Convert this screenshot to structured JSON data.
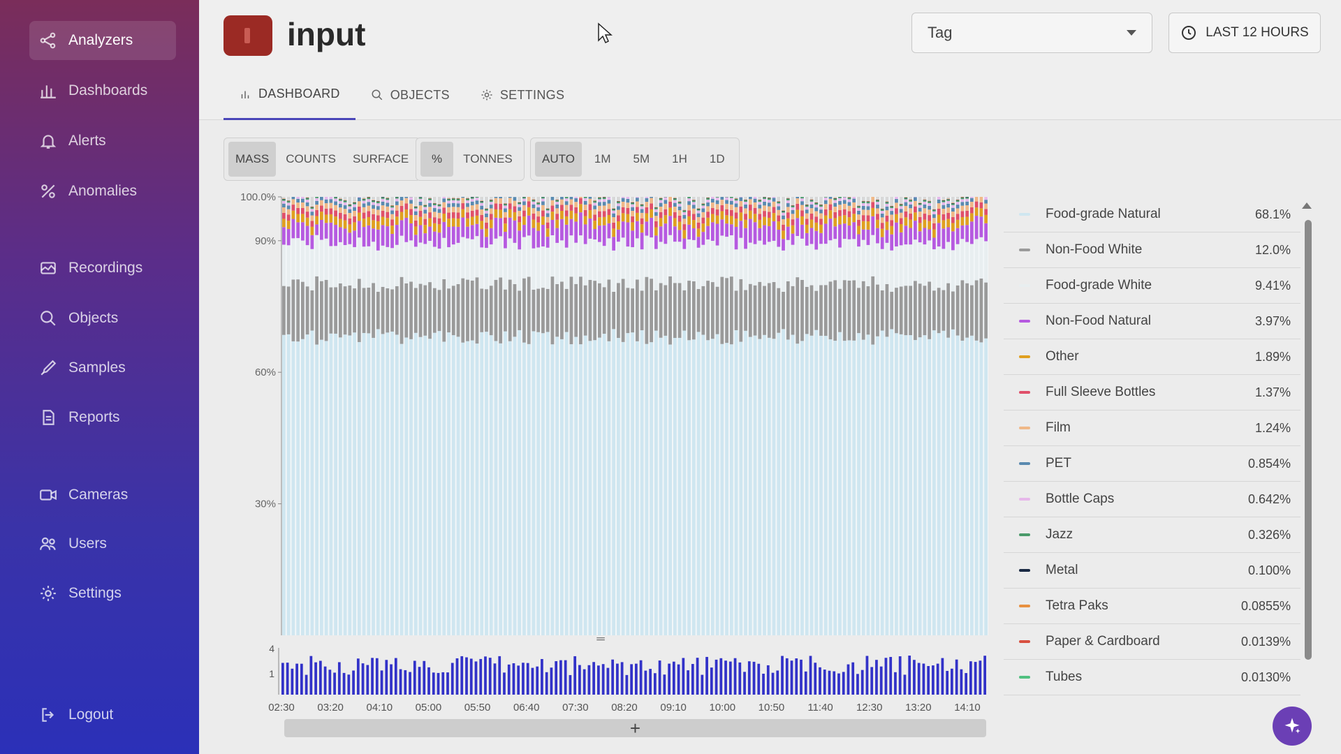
{
  "sidebar": {
    "items": [
      {
        "label": "Analyzers",
        "icon": "analyzers-icon"
      },
      {
        "label": "Dashboards",
        "icon": "bar-chart-icon"
      },
      {
        "label": "Alerts",
        "icon": "bell-icon"
      },
      {
        "label": "Anomalies",
        "icon": "anomalies-icon"
      },
      {
        "label": "Recordings",
        "icon": "recordings-icon"
      },
      {
        "label": "Objects",
        "icon": "search-icon"
      },
      {
        "label": "Samples",
        "icon": "pipette-icon"
      },
      {
        "label": "Reports",
        "icon": "report-icon"
      },
      {
        "label": "Cameras",
        "icon": "camera-icon"
      },
      {
        "label": "Users",
        "icon": "users-icon"
      },
      {
        "label": "Settings",
        "icon": "gear-icon"
      }
    ],
    "logout": "Logout"
  },
  "header": {
    "title": "input",
    "tabs": [
      "DASHBOARD",
      "OBJECTS",
      "SETTINGS"
    ],
    "tag_select": "Tag",
    "time_range": "LAST 12 HOURS"
  },
  "toggles": {
    "metric": [
      "MASS",
      "COUNTS",
      "SURFACE"
    ],
    "unit": [
      "%",
      "TONNES"
    ],
    "interval": [
      "AUTO",
      "1M",
      "5M",
      "1H",
      "1D"
    ]
  },
  "chart_data": {
    "type": "bar",
    "stacked": true,
    "y_ticks": [
      "100.0%",
      "90%",
      "60%",
      "30%"
    ],
    "x_ticks": [
      "02:30",
      "03:20",
      "04:10",
      "05:00",
      "05:50",
      "06:40",
      "07:30",
      "08:20",
      "09:10",
      "10:00",
      "10:50",
      "11:40",
      "12:30",
      "13:20",
      "14:10"
    ],
    "overview_y_ticks": [
      "4",
      "1"
    ],
    "series": [
      {
        "name": "Food-grade Natural",
        "value_pct": 68.1,
        "label": "68.1%",
        "color": "#cfe6f0"
      },
      {
        "name": "Non-Food White",
        "value_pct": 12.0,
        "label": "12.0%",
        "color": "#9a9a9a"
      },
      {
        "name": "Food-grade White",
        "value_pct": 9.41,
        "label": "9.41%",
        "color": "#e8eef0"
      },
      {
        "name": "Non-Food Natural",
        "value_pct": 3.97,
        "label": "3.97%",
        "color": "#b65ae0"
      },
      {
        "name": "Other",
        "value_pct": 1.89,
        "label": "1.89%",
        "color": "#e0a020"
      },
      {
        "name": "Full Sleeve Bottles",
        "value_pct": 1.37,
        "label": "1.37%",
        "color": "#e0506a"
      },
      {
        "name": "Film",
        "value_pct": 1.24,
        "label": "1.24%",
        "color": "#f0b888"
      },
      {
        "name": "PET",
        "value_pct": 0.854,
        "label": "0.854%",
        "color": "#5a8ab0"
      },
      {
        "name": "Bottle Caps",
        "value_pct": 0.642,
        "label": "0.642%",
        "color": "#e6b8ea"
      },
      {
        "name": "Jazz",
        "value_pct": 0.326,
        "label": "0.326%",
        "color": "#4a9a6a"
      },
      {
        "name": "Metal",
        "value_pct": 0.1,
        "label": "0.100%",
        "color": "#1a2a44"
      },
      {
        "name": "Tetra Paks",
        "value_pct": 0.0855,
        "label": "0.0855%",
        "color": "#e89040"
      },
      {
        "name": "Paper & Cardboard",
        "value_pct": 0.0139,
        "label": "0.0139%",
        "color": "#d85040"
      },
      {
        "name": "Tubes",
        "value_pct": 0.013,
        "label": "0.0130%",
        "color": "#50c080"
      }
    ]
  },
  "range_control": "+"
}
